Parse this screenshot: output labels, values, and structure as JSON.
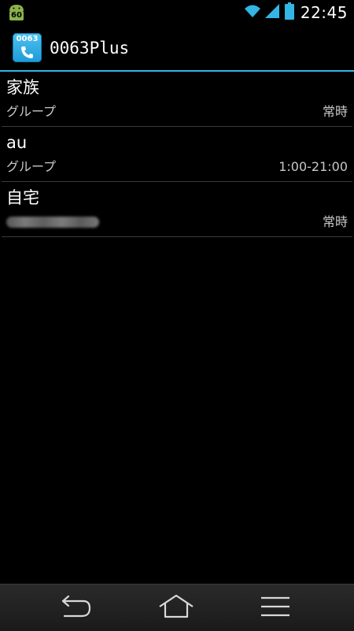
{
  "status_bar": {
    "badge_text": "60",
    "time": "22:45",
    "icons": [
      "wifi-icon",
      "signal-icon",
      "battery-icon"
    ],
    "accent_color": "#33b5e5"
  },
  "action_bar": {
    "app_icon_text": "0063",
    "title": "0063Plus",
    "divider_color": "#33b5e5"
  },
  "list": {
    "items": [
      {
        "title": "家族",
        "subtitle": "グループ",
        "schedule": "常時"
      },
      {
        "title": "au",
        "subtitle": "グループ",
        "schedule": "1:00-21:00"
      },
      {
        "title": "自宅",
        "subtitle": "",
        "subtitle_blurred": true,
        "schedule": "常時"
      }
    ]
  },
  "nav_bar": {
    "buttons": [
      "back-icon",
      "home-icon",
      "menu-icon"
    ]
  }
}
